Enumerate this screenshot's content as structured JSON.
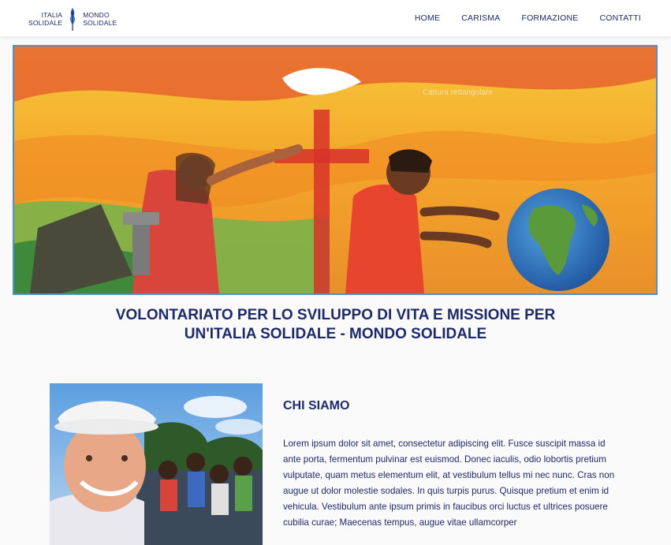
{
  "nav": {
    "logo_left_1": "ITALIA",
    "logo_left_2": "SOLIDALE",
    "logo_right_1": "MONDO",
    "logo_right_2": "SOLIDALE",
    "items": [
      "HOME",
      "CARISMA",
      "FORMAZIONE",
      "CONTATTI"
    ]
  },
  "hero": {
    "watermark": "Cattura rettangolare"
  },
  "headline": {
    "line1": "VOLONTARIATO PER LO SVILUPPO DI VITA E MISSIONE PER",
    "line2": "UN'ITALIA SOLIDALE - MONDO SOLIDALE"
  },
  "about": {
    "title": "CHI SIAMO",
    "body": "Lorem ipsum dolor sit amet, consectetur adipiscing elit. Fusce suscipit massa id ante porta, fermentum pulvinar est euismod. Donec iaculis, odio lobortis pretium vulputate, quam metus elementum elit, at vestibulum tellus mi nec nunc. Cras non augue ut dolor molestie sodales. In quis turpis purus. Quisque pretium et enim id vehicula. Vestibulum ante ipsum primis in faucibus orci luctus et ultrices posuere cubilia curae; Maecenas tempus, augue vitae ullamcorper"
  },
  "colors": {
    "brand": "#1d2a6b",
    "hero_border": "#4a90d9"
  }
}
